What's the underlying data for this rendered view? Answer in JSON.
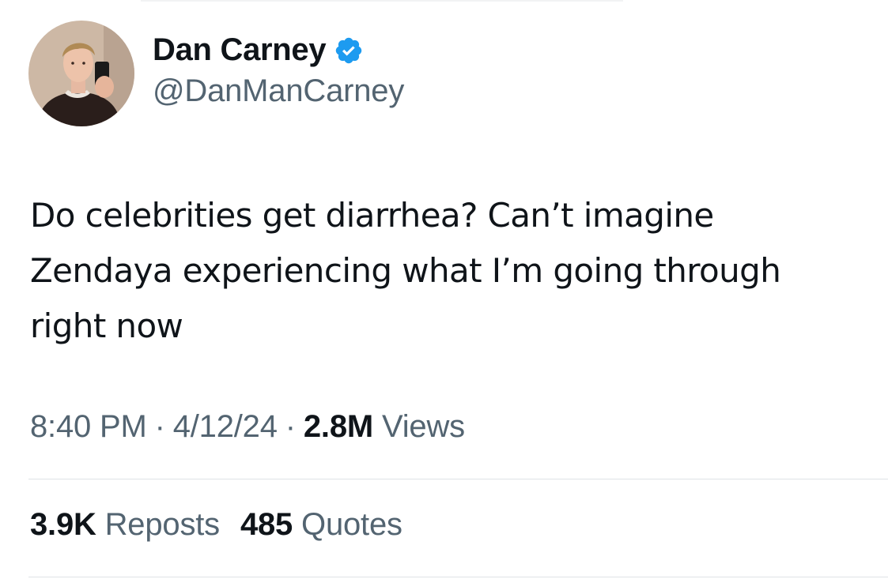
{
  "author": {
    "display_name": "Dan Carney",
    "handle": "@DanManCarney",
    "verified": true,
    "verified_color": "#1d9bf0"
  },
  "tweet": {
    "text": "Do celebrities get diarrhea? Can’t imagine\nZendaya experiencing what I’m going through\nright now"
  },
  "meta": {
    "time": "8:40 PM",
    "separator": "·",
    "date": "4/12/24",
    "views_count": "2.8M",
    "views_label": "Views"
  },
  "stats": {
    "reposts_count": "3.9K",
    "reposts_label": "Reposts",
    "quotes_count": "485",
    "quotes_label": "Quotes"
  },
  "colors": {
    "text_primary": "#0f1419",
    "text_secondary": "#536471",
    "divider": "#dfe3e6"
  }
}
